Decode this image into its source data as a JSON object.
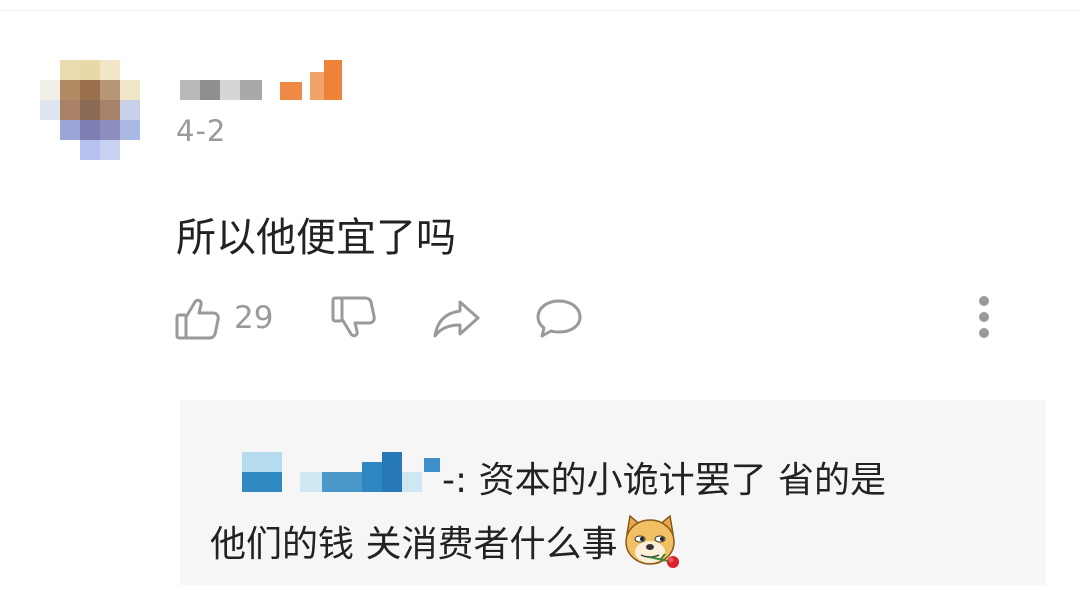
{
  "comment": {
    "date": "4-2",
    "text": "所以他便宜了吗",
    "like_count": "29"
  },
  "reply": {
    "separator": "-:",
    "text_line1": " 资本的小诡计罢了 省的是",
    "text_line2": "他们的钱 关消费者什么事",
    "emoji": "doge-with-rose"
  },
  "icons": [
    "thumbs-up-icon",
    "thumbs-down-icon",
    "share-icon",
    "comment-bubble-icon",
    "more-vertical-icon"
  ],
  "colors": {
    "text": "#222222",
    "muted": "#9a9a9a",
    "reply_bg": "#f6f6f6",
    "badge_orange": "#ee8a45"
  }
}
